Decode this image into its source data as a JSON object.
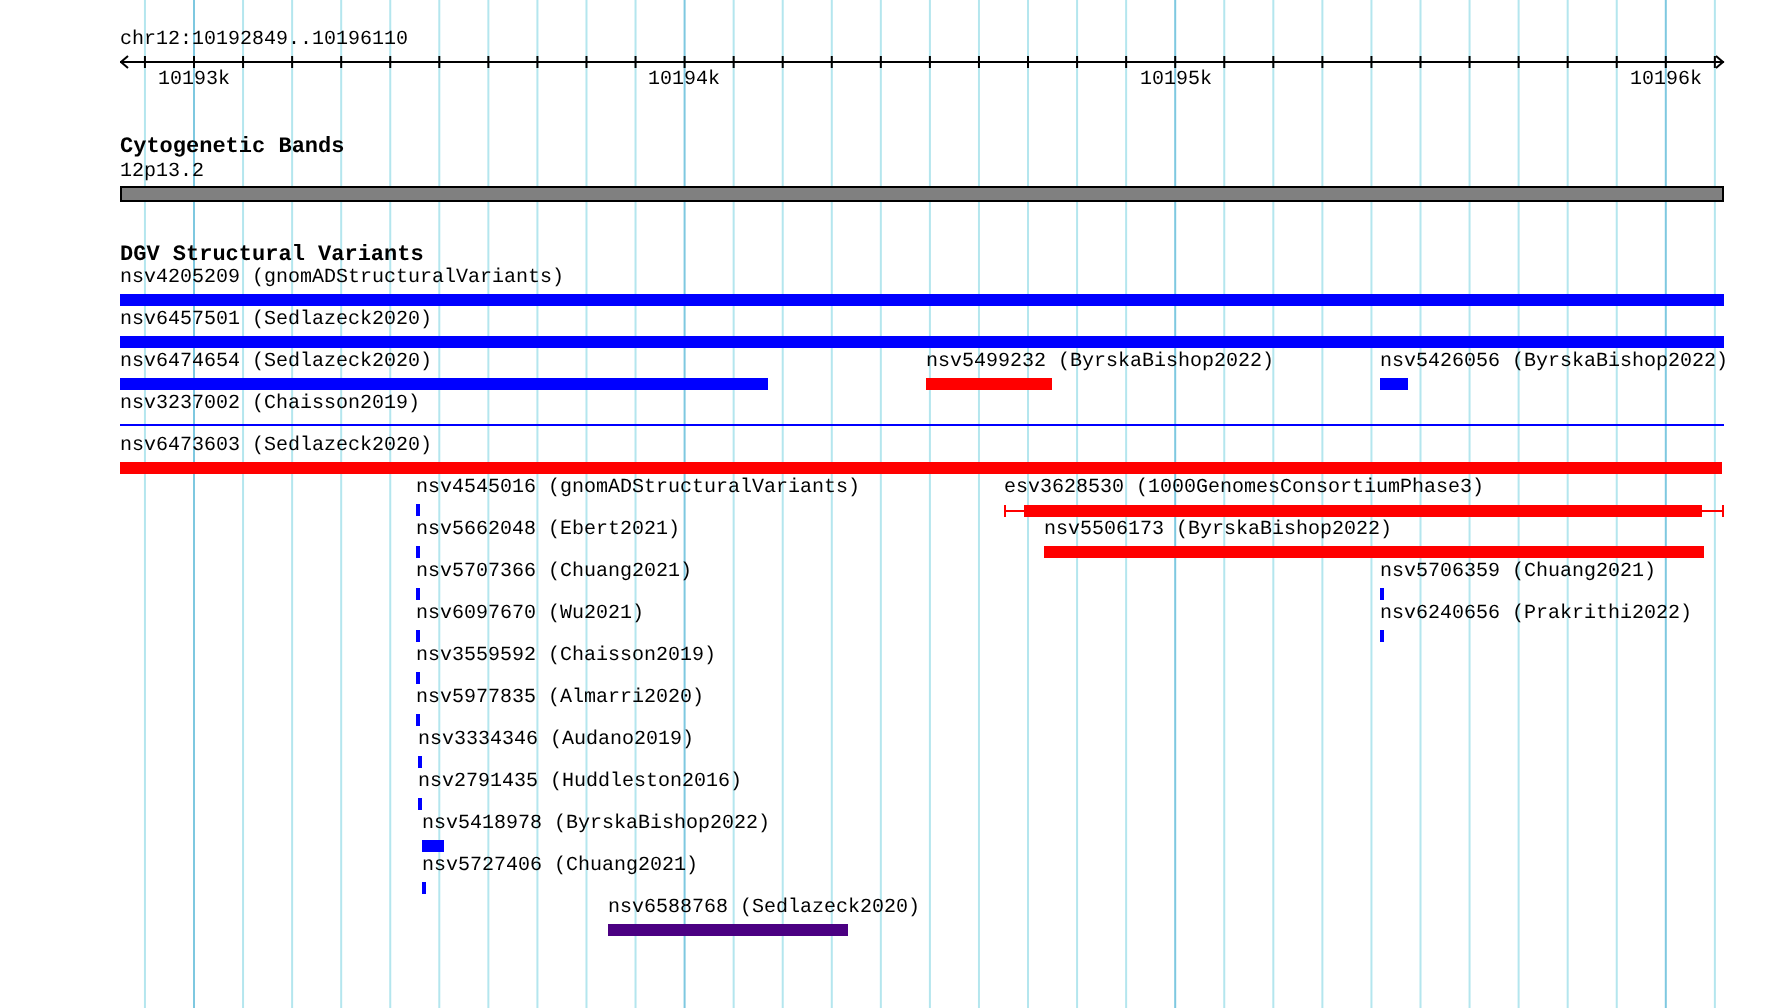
{
  "location": "chr12:10192849..10196110",
  "ruler": {
    "ticks": [
      "10193k",
      "10194k",
      "10195k",
      "10196k"
    ]
  },
  "cytoband_track": {
    "title": "Cytogenetic Bands",
    "band": "12p13.2"
  },
  "variant_track": {
    "title": "DGV Structural Variants",
    "features": [
      {
        "label": "nsv4205209 (gnomADStructuralVariants)",
        "color": "#0000ff",
        "kind": "bar"
      },
      {
        "label": "nsv6457501 (Sedlazeck2020)",
        "color": "#0000ff",
        "kind": "bar"
      },
      {
        "label": "nsv6474654 (Sedlazeck2020)",
        "color": "#0000ff",
        "kind": "bar"
      },
      {
        "label": "nsv5499232 (ByrskaBishop2022)",
        "color": "#ff0000",
        "kind": "bar"
      },
      {
        "label": "nsv5426056 (ByrskaBishop2022)",
        "color": "#0000ff",
        "kind": "bar"
      },
      {
        "label": "nsv3237002 (Chaisson2019)",
        "color": "#0000ff",
        "kind": "line"
      },
      {
        "label": "nsv6473603 (Sedlazeck2020)",
        "color": "#ff0000",
        "kind": "bar"
      },
      {
        "label": "nsv4545016 (gnomADStructuralVariants)",
        "color": "#0000ff",
        "kind": "bar"
      },
      {
        "label": "esv3628530 (1000GenomesConsortiumPhase3)",
        "color": "#ff0000",
        "kind": "whiskered"
      },
      {
        "label": "nsv5662048 (Ebert2021)",
        "color": "#0000ff",
        "kind": "bar"
      },
      {
        "label": "nsv5506173 (ByrskaBishop2022)",
        "color": "#ff0000",
        "kind": "bar"
      },
      {
        "label": "nsv5707366 (Chuang2021)",
        "color": "#0000ff",
        "kind": "bar"
      },
      {
        "label": "nsv5706359 (Chuang2021)",
        "color": "#0000ff",
        "kind": "bar"
      },
      {
        "label": "nsv6097670 (Wu2021)",
        "color": "#0000ff",
        "kind": "bar"
      },
      {
        "label": "nsv6240656 (Prakrithi2022)",
        "color": "#0000ff",
        "kind": "bar"
      },
      {
        "label": "nsv3559592 (Chaisson2019)",
        "color": "#0000ff",
        "kind": "bar"
      },
      {
        "label": "nsv5977835 (Almarri2020)",
        "color": "#0000ff",
        "kind": "bar"
      },
      {
        "label": "nsv3334346 (Audano2019)",
        "color": "#0000ff",
        "kind": "bar"
      },
      {
        "label": "nsv2791435 (Huddleston2016)",
        "color": "#0000ff",
        "kind": "bar"
      },
      {
        "label": "nsv5418978 (ByrskaBishop2022)",
        "color": "#0000ff",
        "kind": "bar"
      },
      {
        "label": "nsv5727406 (Chuang2021)",
        "color": "#0000ff",
        "kind": "bar"
      },
      {
        "label": "nsv6588768 (Sedlazeck2020)",
        "color": "#4b0082",
        "kind": "bar"
      }
    ]
  }
}
